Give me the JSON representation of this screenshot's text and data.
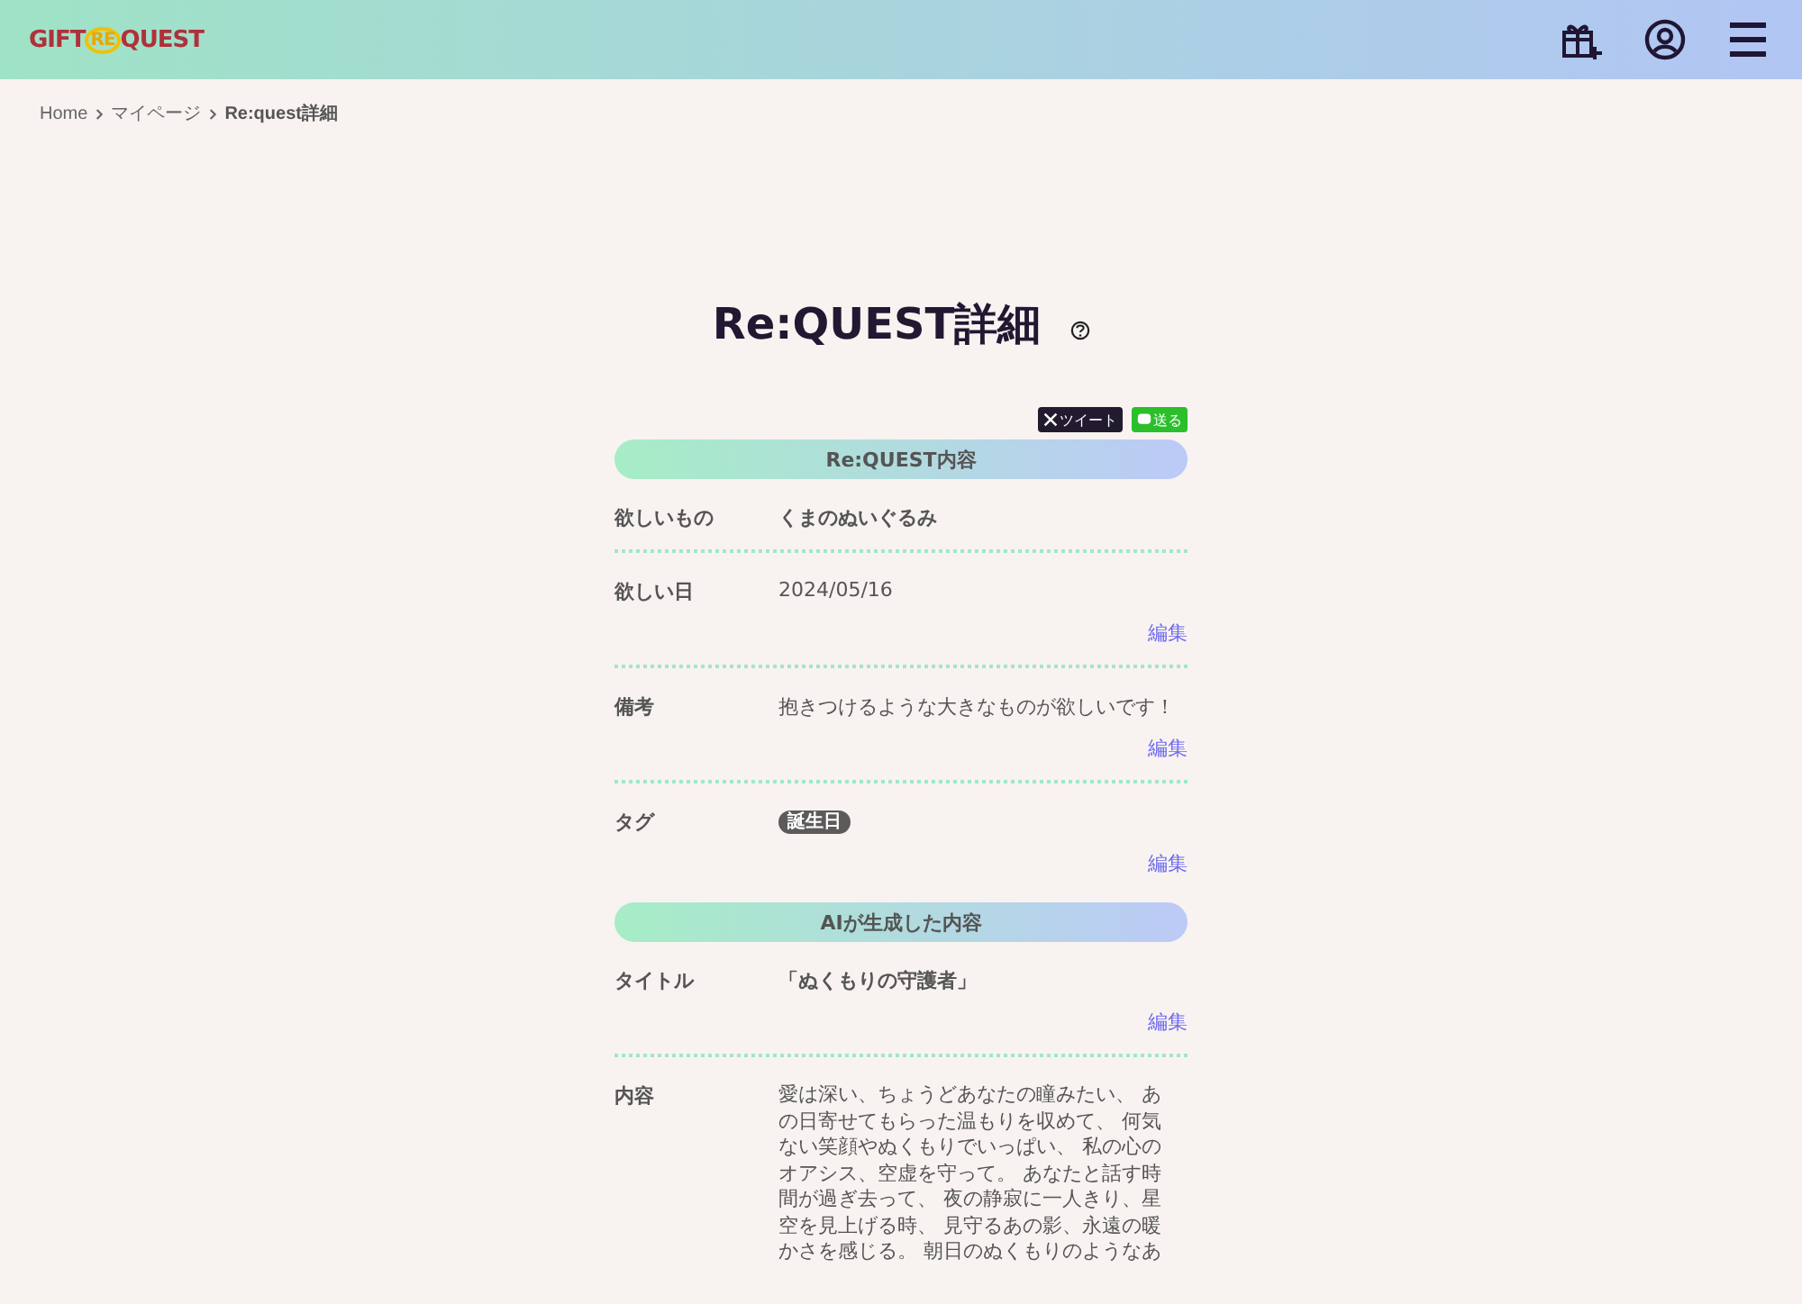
{
  "logo": {
    "parts": [
      "GIFT",
      "RE",
      "QUEST"
    ]
  },
  "breadcrumb": [
    {
      "label": "Home",
      "current": false
    },
    {
      "label": "マイページ",
      "current": false
    },
    {
      "label": "Re:quest詳細",
      "current": true
    }
  ],
  "title": "Re:QUEST詳細",
  "share": {
    "tweet": "ツイート",
    "line": "送る"
  },
  "sections": [
    {
      "heading": "Re:QUEST内容",
      "rows": [
        {
          "kind": "text",
          "label": "欲しいもの",
          "value": "くまのぬいぐるみ",
          "bold": true
        },
        {
          "kind": "text",
          "label": "欲しい日",
          "value": "2024/05/16",
          "bold": false,
          "edit": "編集"
        },
        {
          "kind": "text",
          "label": "備考",
          "value": "抱きつけるような大きなものが欲しいです！",
          "bold": false,
          "edit": "編集"
        },
        {
          "kind": "tags",
          "label": "タグ",
          "tags": [
            "誕生日"
          ],
          "edit": "編集"
        }
      ]
    },
    {
      "heading": "AIが生成した内容",
      "rows": [
        {
          "kind": "text",
          "label": "タイトル",
          "value": "「ぬくもりの守護者」",
          "bold": true,
          "edit": "編集"
        },
        {
          "kind": "lines",
          "label": "内容",
          "lines": [
            "愛は深い、ちょうどあなたの瞳みたい、 あ",
            "の日寄せてもらった温もりを収めて、 何気",
            "ない笑顔やぬくもりでいっぱい、 私の心の",
            "オアシス、空虚を守って。 あなたと話す時",
            "間が過ぎ去って、 夜の静寂に一人きり、星",
            "空を見上げる時、 見守るあの影、永遠の暖",
            "かさを感じる。 朝日のぬくもりのようなあ"
          ]
        }
      ]
    }
  ]
}
